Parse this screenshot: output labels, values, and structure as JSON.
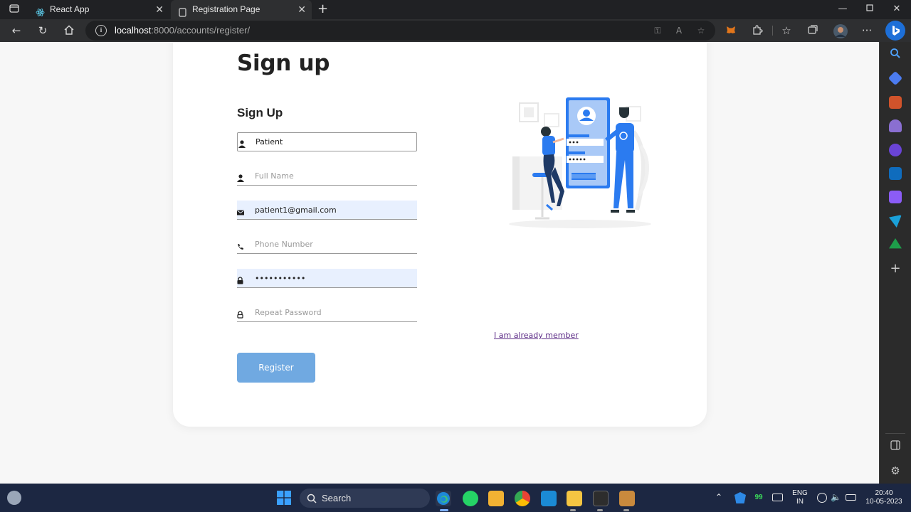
{
  "browser": {
    "tabs": [
      {
        "title": "React App"
      },
      {
        "title": "Registration Page"
      }
    ],
    "url_host": "localhost",
    "url_path": ":8000/accounts/register/"
  },
  "page": {
    "heading": "Sign up",
    "form_title": "Sign Up",
    "role_value": "Patient",
    "fields": {
      "full_name_placeholder": "Full Name",
      "email_value": "patient1@gmail.com",
      "phone_placeholder": "Phone Number",
      "password_value": "•••••••••••",
      "repeat_password_placeholder": "Repeat Password"
    },
    "login_link": "I am already member",
    "register_button": "Register"
  },
  "taskbar": {
    "search_label": "Search",
    "lang_line1": "ENG",
    "lang_line2": "IN",
    "time": "20:40",
    "date": "10-05-2023",
    "badge": "99"
  },
  "colors": {
    "accent": "#70a9e1",
    "illustration_blue": "#2b7bf0",
    "chrome_dark": "#202124",
    "taskbar": "#1c2742"
  }
}
